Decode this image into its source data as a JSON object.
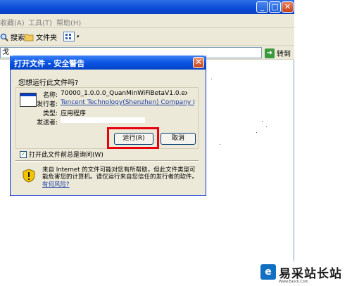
{
  "explorer": {
    "menu": [
      "收藏(A)",
      "工具(T)",
      "帮助(H)"
    ],
    "toolbar": {
      "search_label": "搜索",
      "folders_label": "文件夹"
    },
    "address": {
      "value": "戈",
      "go_label": "转到"
    }
  },
  "dialog": {
    "title": "打开文件 - 安全警告",
    "close_glyph": "✕",
    "question": "您想运行此文件吗?",
    "fields": [
      {
        "label": "名称:",
        "value": "70000_1.0.0.0_QuanMinWiFiBetaV1.0.exe",
        "link": false
      },
      {
        "label": "发行者:",
        "value": "Tencent Technology(Shenzhen) Company Li...",
        "link": true
      },
      {
        "label": "类型:",
        "value": "应用程序",
        "link": false
      },
      {
        "label": "发送者:",
        "value": "",
        "link": false
      }
    ],
    "run_label": "运行(R)",
    "cancel_label": "取消",
    "checkbox_label": "打开此文件前总是询问(W)",
    "checkbox_checked": true,
    "warning_text": "来自 Internet 的文件可能对您有所帮助，但此文件类型可能危害您的计算机。请仅运行来自您信任的发行者的软件。",
    "risk_link": "有何风险?"
  },
  "watermark": {
    "logo_glyph": "e",
    "text": "易采站长站",
    "subtext": "Www.Easck.Com"
  },
  "colors": {
    "xp_blue": "#0a55e5",
    "dialog_bg": "#ece9d8",
    "highlight_red": "#e8000d",
    "link_blue": "#1d3ea8"
  }
}
